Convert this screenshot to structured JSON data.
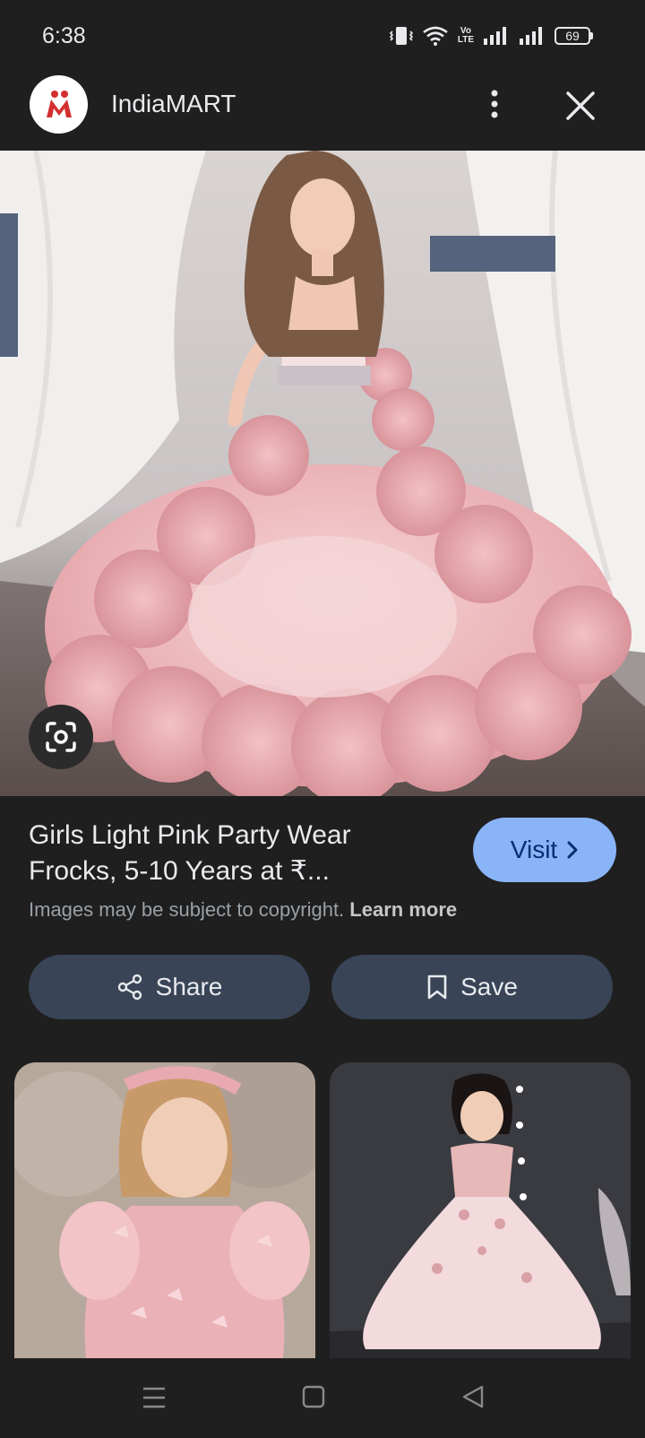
{
  "status_bar": {
    "time": "6:38",
    "lte_label_top": "Vo",
    "lte_label_bottom": "LTE",
    "battery": "69"
  },
  "header": {
    "site_name": "IndiaMART",
    "logo_letter": "M",
    "more_icon": "more-vert-icon",
    "close_icon": "close-icon"
  },
  "result": {
    "title": "Girls Light Pink Party Wear Frocks, 5-10 Years at ₹...",
    "visit_label": "Visit",
    "copyright_text": "Images may be subject to copyright.",
    "learn_more": "Learn more"
  },
  "actions": {
    "share_label": "Share",
    "save_label": "Save"
  },
  "colors": {
    "background": "#1f1f1f",
    "visit_button": "#8ab4f8",
    "action_button": "#394457",
    "dress_pink": "#e8a9ae"
  }
}
